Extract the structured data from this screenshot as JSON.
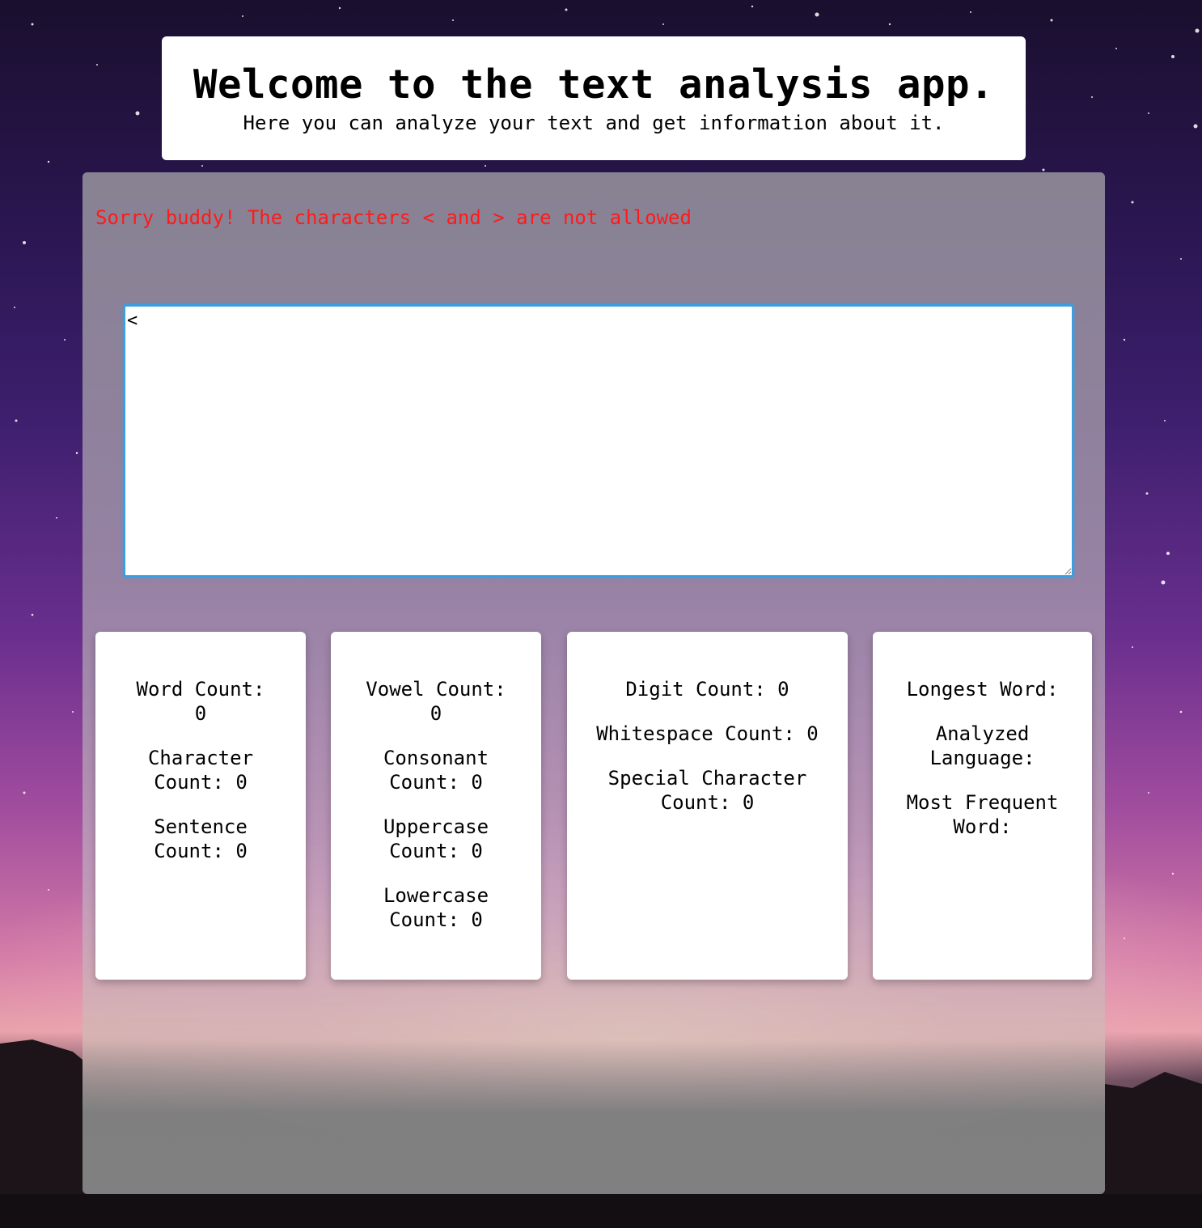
{
  "header": {
    "title": "Welcome to the text analysis app.",
    "subtitle": "Here you can analyze your text and get information about it."
  },
  "error": {
    "message": "Sorry buddy! The characters < and > are not allowed",
    "color": "#ff1a1a"
  },
  "input": {
    "value": "<",
    "focus_color": "#3a9ee0"
  },
  "stats": {
    "card1": {
      "word_count": "Word Count: 0",
      "character_count": "Character Count: 0",
      "sentence_count": "Sentence Count: 0"
    },
    "card2": {
      "vowel_count": "Vowel Count: 0",
      "consonant_count": "Consonant Count: 0",
      "uppercase_count": "Uppercase Count: 0",
      "lowercase_count": "Lowercase Count: 0"
    },
    "card3": {
      "digit_count": "Digit Count: 0",
      "whitespace_count": "Whitespace Count: 0",
      "special_character_count": "Special Character Count: 0"
    },
    "card4": {
      "longest_word": "Longest Word:",
      "analyzed_language": "Analyzed Language:",
      "most_frequent_word": "Most Frequent Word:"
    }
  }
}
